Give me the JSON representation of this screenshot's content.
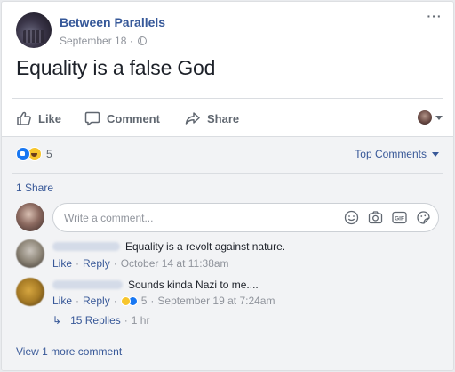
{
  "post": {
    "page_name": "Between Parallels",
    "date": "September 18",
    "separator": "·",
    "more": "···",
    "text": "Equality is a false God"
  },
  "actions": {
    "like": "Like",
    "comment": "Comment",
    "share": "Share"
  },
  "reactions": {
    "count": "5",
    "sort_label": "Top Comments"
  },
  "shares": "1 Share",
  "composer": {
    "placeholder": "Write a comment..."
  },
  "comments": [
    {
      "text": "Equality is a revolt against nature.",
      "like": "Like",
      "reply": "Reply",
      "time": "October 14 at 11:38am"
    },
    {
      "text": "Sounds kinda Nazi to me....",
      "like": "Like",
      "reply": "Reply",
      "reaction_count": "5",
      "time": "September 19 at 7:24am",
      "replies_label": "15 Replies",
      "replies_time": "1 hr"
    }
  ],
  "view_more": "View 1 more comment",
  "colors": {
    "link": "#385898",
    "page_name": "#365899",
    "muted": "#90949c",
    "like_blue": "#1877f2",
    "haha_yellow": "#f7c52c"
  }
}
